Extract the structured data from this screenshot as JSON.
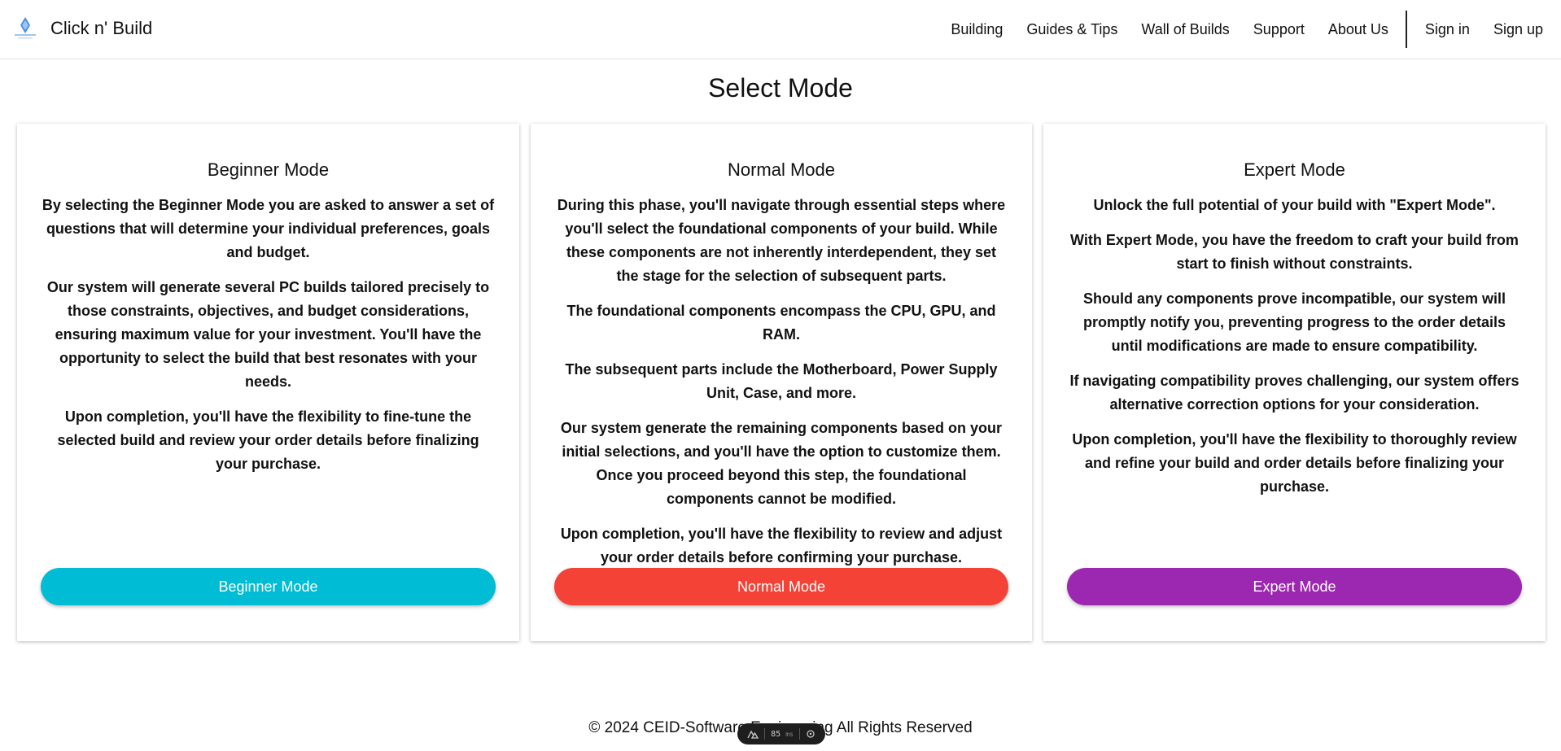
{
  "header": {
    "brand_name": "Click n' Build",
    "nav": [
      {
        "label": "Building"
      },
      {
        "label": "Guides & Tips"
      },
      {
        "label": "Wall of Builds"
      },
      {
        "label": "Support"
      },
      {
        "label": "About Us"
      },
      {
        "label": "Sign in"
      },
      {
        "label": "Sign up"
      }
    ]
  },
  "main": {
    "title": "Select Mode",
    "cards": [
      {
        "title": "Beginner Mode",
        "paragraphs": [
          "By selecting the Beginner Mode you are asked to answer a set of questions that will determine your individual preferences, goals and budget.",
          "Our system will generate several PC builds tailored precisely to those constraints, objectives, and budget considerations, ensuring maximum value for your investment. You'll have the opportunity to select the build that best resonates with your needs.",
          "Upon completion, you'll have the flexibility to fine-tune the selected build and review your order details before finalizing your purchase."
        ],
        "button_label": "Beginner Mode",
        "button_color": "#00bcd4"
      },
      {
        "title": "Normal Mode",
        "paragraphs": [
          "During this phase, you'll navigate through essential steps where you'll select the foundational components of your build. While these components are not inherently interdependent, they set the stage for the selection of subsequent parts.",
          "The foundational components encompass the CPU, GPU, and RAM.",
          "The subsequent parts include the Motherboard, Power Supply Unit, Case, and more.",
          "Our system generate the remaining components based on your initial selections, and you'll have the option to customize them. Once you proceed beyond this step, the foundational components cannot be modified.",
          "Upon completion, you'll have the flexibility to review and adjust your order details before confirming your purchase."
        ],
        "button_label": "Normal Mode",
        "button_color": "#f44336"
      },
      {
        "title": "Expert Mode",
        "paragraphs": [
          "Unlock the full potential of your build with \"Expert Mode\".",
          "With Expert Mode, you have the freedom to craft your build from start to finish without constraints.",
          "Should any components prove incompatible, our system will promptly notify you, preventing progress to the order details until modifications are made to ensure compatibility.",
          "If navigating compatibility proves challenging, our system offers alternative correction options for your consideration.",
          "Upon completion, you'll have the flexibility to thoroughly review and refine your build and order details before finalizing your purchase."
        ],
        "button_label": "Expert Mode",
        "button_color": "#9c27b0"
      }
    ]
  },
  "footer": {
    "text": "© 2024 CEID-Software Engineering All Rights Reserved"
  },
  "perf_overlay": {
    "ms_value": "85",
    "ms_unit": "ms"
  }
}
